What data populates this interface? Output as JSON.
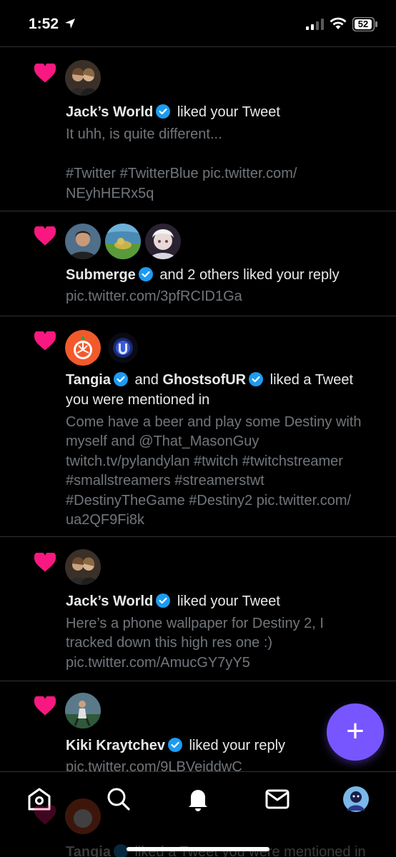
{
  "status_bar": {
    "time": "1:52",
    "battery": "52"
  },
  "notifications": [
    {
      "actor_primary": "Jack’s World",
      "action": " liked your Tweet",
      "snippet_lines": [
        "It uhh, is quite different...",
        "",
        "#Twitter #TwitterBlue pic.twitter.com/",
        "NEyhHERx5q"
      ]
    },
    {
      "actor_primary": "Submerge",
      "action": " and 2 others liked your reply",
      "snippet_lines": [
        " pic.twitter.com/3pfRCID1Ga"
      ]
    },
    {
      "actor_primary": "Tangia",
      "conjunction": " and ",
      "actor_secondary": "GhostsofUR",
      "action": " liked a Tweet",
      "action_line2": "you were mentioned in",
      "snippet_lines": [
        "Come have a beer and play some Destiny with",
        "myself and @That_MasonGuy",
        "twitch.tv/pylandylan #twitch #twitchstreamer",
        "#smallstreamers #streamerstwt",
        "#DestinyTheGame #Destiny2 pic.twitter.com/",
        "ua2QF9Fi8k"
      ]
    },
    {
      "actor_primary": "Jack’s World",
      "action": " liked your Tweet",
      "snippet_lines": [
        "Here’s a phone wallpaper for Destiny 2, I",
        "tracked down this high res one :)",
        "pic.twitter.com/AmucGY7yY5"
      ]
    },
    {
      "actor_primary": "Kiki Kraytchev",
      "action": " liked your reply",
      "snippet_lines": [
        " pic.twitter.com/9LBVeiddwC"
      ]
    }
  ],
  "bleed_item": {
    "actor_primary": "Tangia",
    "action": " liked a Tweet you were mentioned in"
  },
  "compose": {
    "label": "+"
  },
  "colors": {
    "heart": "#f91880",
    "verified": "#1d9bf0",
    "fab": "#7856ff"
  },
  "tabs": [
    "home-icon",
    "search-icon",
    "notifications-icon",
    "messages-icon",
    "profile-avatar"
  ]
}
